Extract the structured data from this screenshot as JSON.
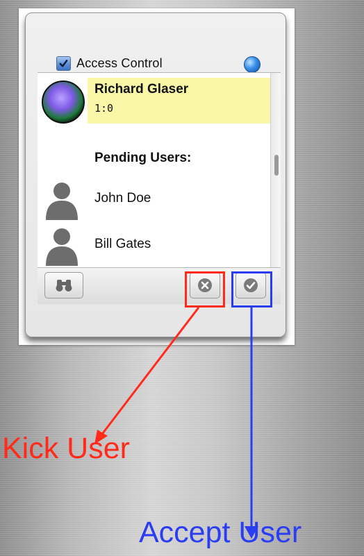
{
  "window": {
    "title": "Access Control",
    "access_control_checked": true
  },
  "current_user": {
    "name": "Richard Glaser",
    "subtitle": "1:0"
  },
  "pending": {
    "header": "Pending Users:",
    "users": [
      {
        "name": "John Doe"
      },
      {
        "name": "Bill Gates"
      }
    ]
  },
  "toolbar": {
    "buttons": [
      {
        "icon": "binoculars-icon"
      },
      {
        "icon": "x-circle-icon"
      },
      {
        "icon": "checkmark-circle-icon"
      }
    ]
  },
  "annotations": {
    "kick_label": "Kick User",
    "accept_label": "Accept User",
    "kick_color": "#ff2a1a",
    "accept_color": "#2b3df0"
  }
}
